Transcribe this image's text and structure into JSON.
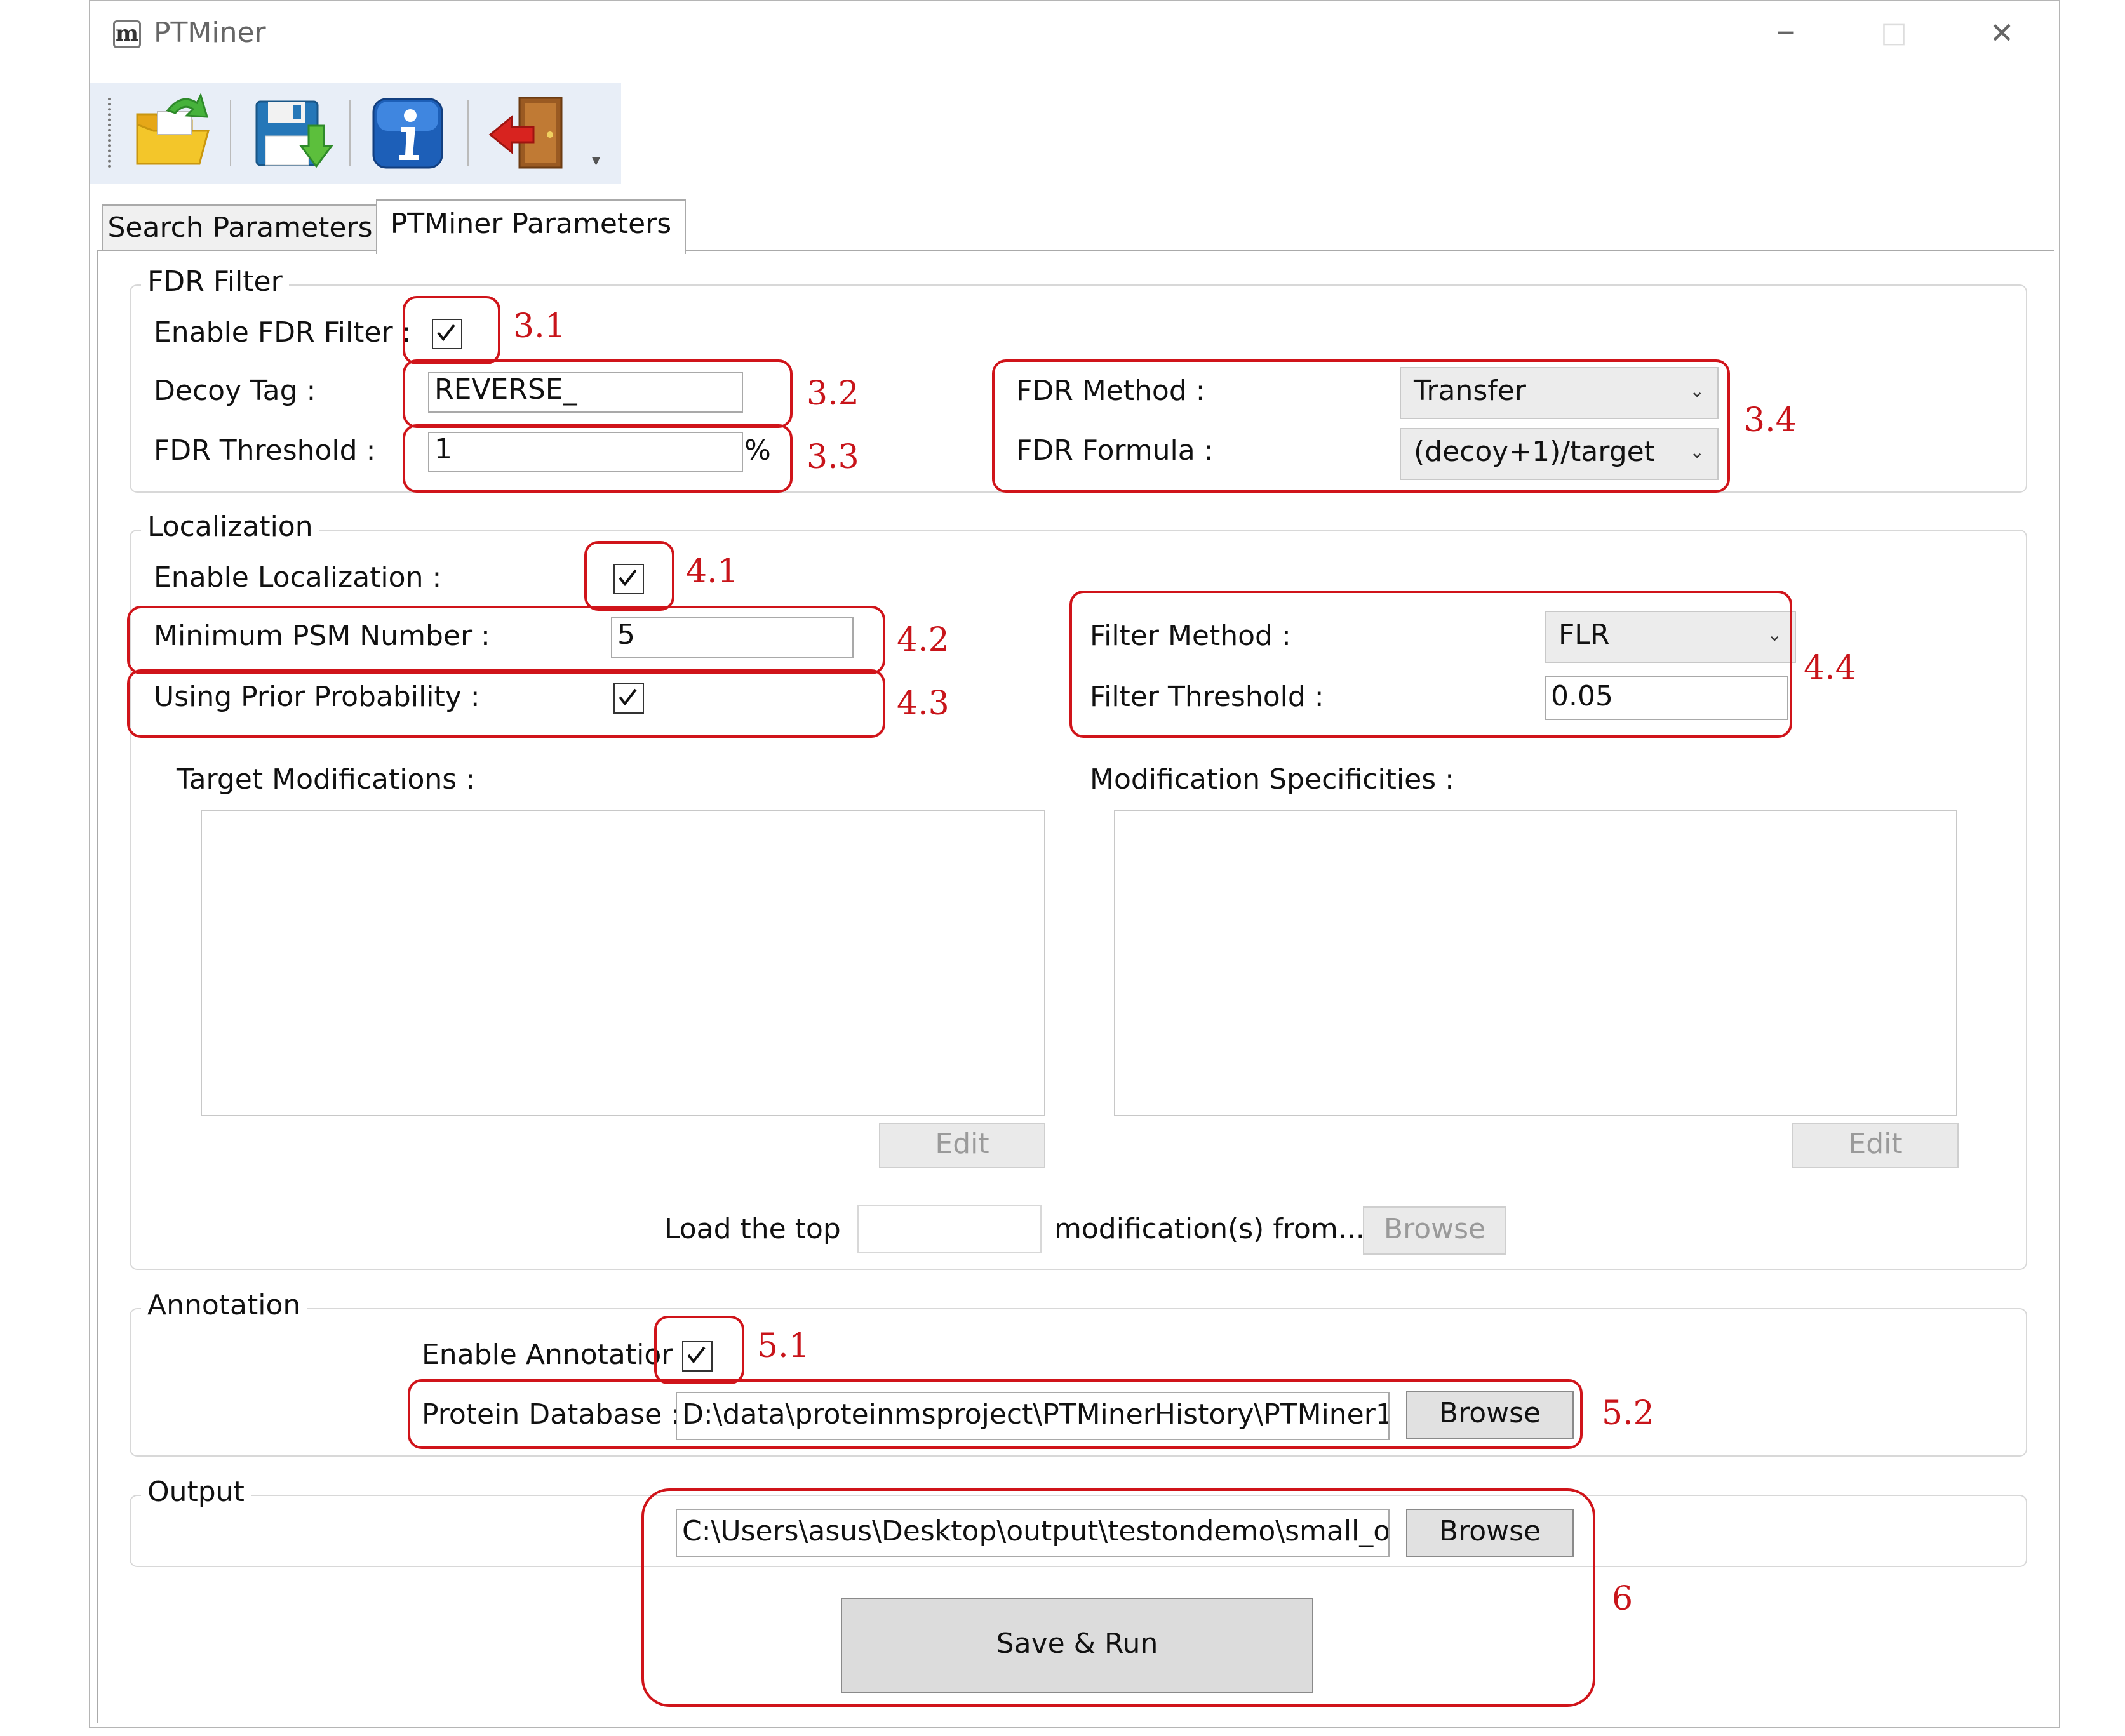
{
  "window": {
    "app_icon": "m",
    "title": "PTMiner",
    "controls": {
      "minimize": "─",
      "maximize": "□",
      "close": "✕"
    }
  },
  "toolbar": {
    "buttons": [
      {
        "icon": "open-folder-icon"
      },
      {
        "icon": "save-disk-icon"
      },
      {
        "icon": "info-icon"
      },
      {
        "icon": "exit-door-icon"
      }
    ],
    "overflow_glyph": "▾"
  },
  "tabs": [
    {
      "label": "Search Parameters",
      "active": false
    },
    {
      "label": "PTMiner Parameters",
      "active": true
    }
  ],
  "fdr": {
    "title": "FDR Filter",
    "enable_label": "Enable FDR Filter :",
    "enable_checked": true,
    "decoy_label": "Decoy Tag :",
    "decoy_value": "REVERSE_",
    "threshold_label": "FDR Threshold :",
    "threshold_value": "1",
    "threshold_unit": "%",
    "method_label": "FDR Method :",
    "method_value": "Transfer",
    "formula_label": "FDR Formula :",
    "formula_value": "(decoy+1)/target"
  },
  "localization": {
    "title": "Localization",
    "enable_label": "Enable Localization :",
    "enable_checked": true,
    "min_psm_label": "Minimum PSM Number :",
    "min_psm_value": "5",
    "prior_label": "Using Prior Probability :",
    "prior_checked": true,
    "filter_method_label": "Filter Method :",
    "filter_method_value": "FLR",
    "filter_threshold_label": "Filter Threshold :",
    "filter_threshold_value": "0.05",
    "target_mods_label": "Target Modifications :",
    "mod_spec_label": "Modification Specificities :",
    "edit_label": "Edit",
    "load_prefix": "Load the top",
    "load_value": "",
    "load_suffix": "modification(s) from...",
    "browse_label": "Browse"
  },
  "annotation": {
    "title": "Annotation",
    "enable_label": "Enable Annotatior",
    "enable_checked": true,
    "db_label": "Protein Database :",
    "db_value": "D:\\data\\proteinmsproject\\PTMinerHistory\\PTMiner1",
    "browse_label": "Browse"
  },
  "output": {
    "title": "Output",
    "path_value": "C:\\Users\\asus\\Desktop\\output\\testondemo\\small_o",
    "browse_label": "Browse",
    "run_label": "Save & Run"
  },
  "annotations": {
    "a31": "3.1",
    "a32": "3.2",
    "a33": "3.3",
    "a34": "3.4",
    "a41": "4.1",
    "a42": "4.2",
    "a43": "4.3",
    "a44": "4.4",
    "a51": "5.1",
    "a52": "5.2",
    "a6": "6"
  },
  "colors": {
    "annotation_red": "#d0141a",
    "disabled_text": "#9a9a9a"
  }
}
